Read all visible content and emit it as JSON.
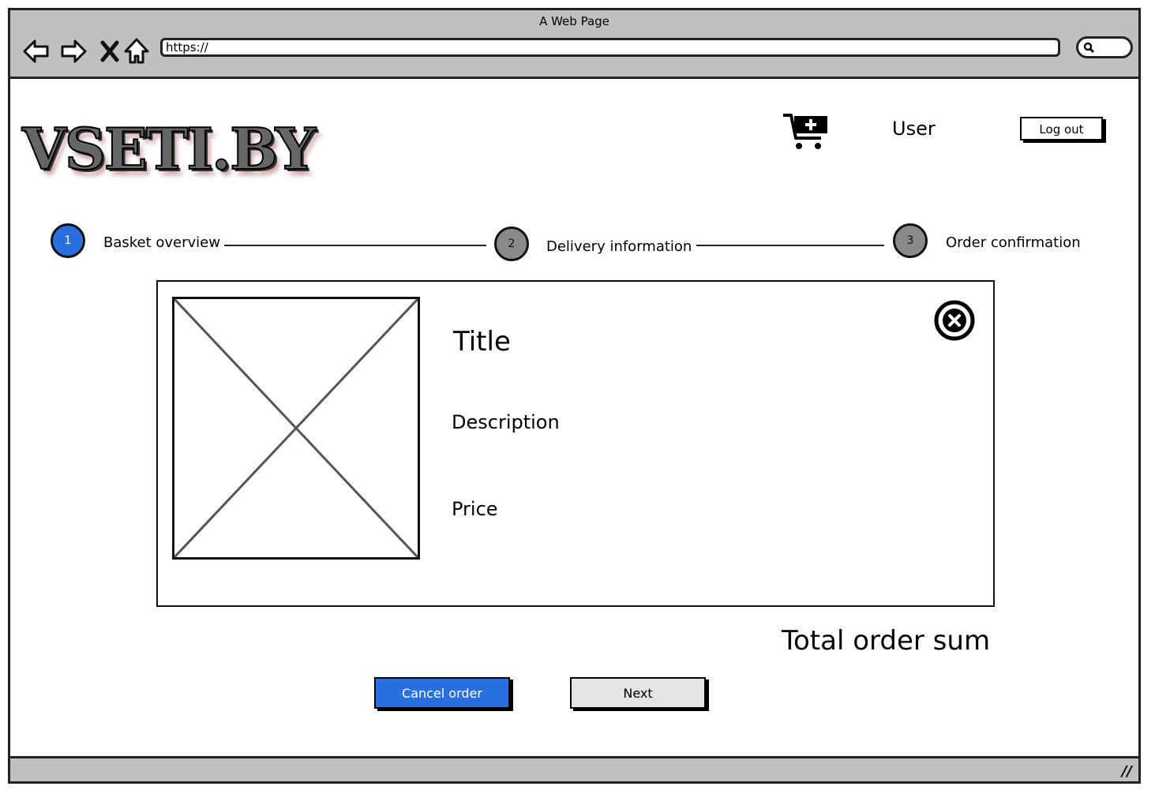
{
  "window": {
    "title": "A Web Page"
  },
  "browser": {
    "url": "https://"
  },
  "header": {
    "logo": "VSETI.BY",
    "user": "User",
    "logout_label": "Log out"
  },
  "steps": [
    {
      "number": "1",
      "label": "Basket overview",
      "active": true
    },
    {
      "number": "2",
      "label": "Delivery information",
      "active": false
    },
    {
      "number": "3",
      "label": "Order confirmation",
      "active": false
    }
  ],
  "product": {
    "title": "Title",
    "description": "Description",
    "price": "Price"
  },
  "summary": {
    "total_label": "Total order sum"
  },
  "actions": {
    "cancel_label": "Cancel order",
    "next_label": "Next"
  },
  "colors": {
    "accent": "#2a6fe0",
    "chrome": "#c0c0c0",
    "inactive_step": "#8a8a8a",
    "secondary_button": "#e4e4e4"
  }
}
